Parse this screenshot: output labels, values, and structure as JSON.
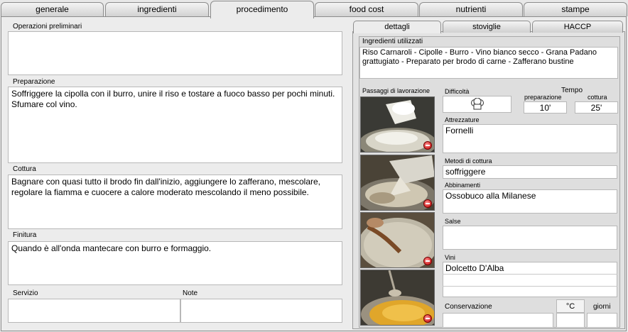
{
  "tabs": [
    {
      "label": "generale",
      "active": false
    },
    {
      "label": "ingredienti",
      "active": false
    },
    {
      "label": "procedimento",
      "active": true
    },
    {
      "label": "food cost",
      "active": false
    },
    {
      "label": "nutrienti",
      "active": false
    },
    {
      "label": "stampe",
      "active": false
    }
  ],
  "left": {
    "operazioni_label": "Operazioni preliminari",
    "operazioni_value": "",
    "preparazione_label": "Preparazione",
    "preparazione_value": "Soffriggere la cipolla con il burro, unire il riso e tostare a fuoco basso per pochi minuti. Sfumare col vino.",
    "cottura_label": "Cottura",
    "cottura_value": "Bagnare con quasi tutto il brodo fin dall'inizio, aggiungere lo zafferano, mescolare, regolare la fiamma e cuocere a calore moderato mescolando il meno possibile.",
    "finitura_label": "Finitura",
    "finitura_value": "Quando è all'onda mantecare con burro e formaggio.",
    "servizio_label": "Servizio",
    "servizio_value": "",
    "note_label": "Note",
    "note_value": ""
  },
  "subtabs": [
    {
      "label": "dettagli",
      "active": true
    },
    {
      "label": "stoviglie",
      "active": false
    },
    {
      "label": "HACCP",
      "active": false
    }
  ],
  "right": {
    "ingredienti_label": "Ingredienti utilizzati",
    "ingredienti_value": "Riso Carnaroli - Cipolle - Burro - Vino bianco secco - Grana Padano grattugiato - Preparato per brodo di carne - Zafferano bustine",
    "passaggi_label": "Passaggi di lavorazione",
    "difficolta_label": "Difficoltà",
    "difficolta_icon": "chef-hat-icon",
    "tempo_label": "Tempo",
    "preparazione_label": "preparazione",
    "preparazione_value": "10'",
    "cottura_label": "cottura",
    "cottura_value": "25'",
    "attrezzature_label": "Attrezzature",
    "attrezzature_value": "Fornelli",
    "metodi_label": "Metodi di cottura",
    "metodi_value": "soffriggere",
    "abbinamenti_label": "Abbinamenti",
    "abbinamenti_value": "Ossobuco alla Milanese",
    "salse_label": "Salse",
    "salse_value": "",
    "vini_label": "Vini",
    "vini_value": "Dolcetto D'Alba",
    "conservazione_label": "Conservazione",
    "conservazione_value": "",
    "gradi_label": "°C",
    "giorni_label": "giorni"
  },
  "photos": [
    {
      "name": "step-photo-1",
      "icon": "delete-icon"
    },
    {
      "name": "step-photo-2",
      "icon": "delete-icon"
    },
    {
      "name": "step-photo-3",
      "icon": "delete-icon"
    },
    {
      "name": "step-photo-4",
      "icon": "delete-icon"
    }
  ],
  "colors": {
    "window_bg": "#ececec",
    "field_bg": "#ffffff",
    "delete_red": "#c00000"
  }
}
